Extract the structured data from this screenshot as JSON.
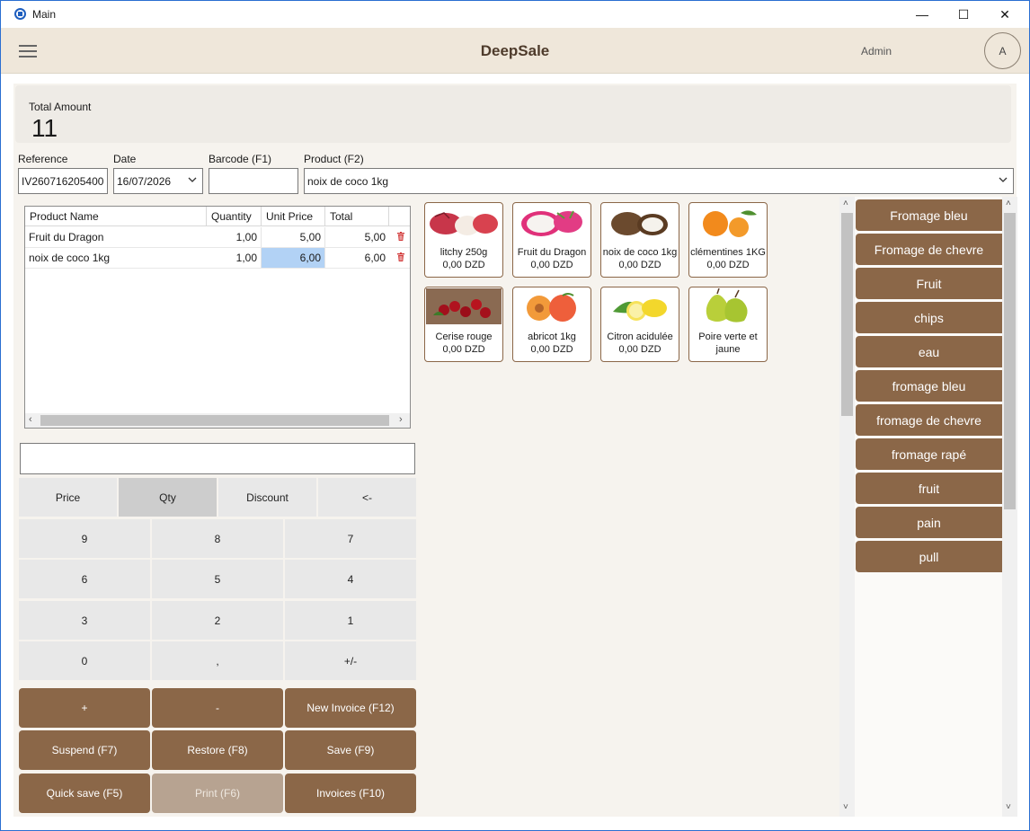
{
  "window": {
    "title": "Main",
    "min_glyph": "—",
    "max_glyph": "☐",
    "close_glyph": "✕"
  },
  "header": {
    "app_name": "DeepSale",
    "user": "Admin",
    "avatar_initial": "A"
  },
  "total": {
    "label": "Total Amount",
    "value": "11"
  },
  "fields": {
    "reference": {
      "label": "Reference",
      "value": "IV260716205400"
    },
    "date": {
      "label": "Date",
      "value": "16/07/2026"
    },
    "barcode": {
      "label": "Barcode (F1)",
      "value": ""
    },
    "product": {
      "label": "Product (F2)",
      "value": "noix de coco 1kg"
    }
  },
  "grid": {
    "columns": [
      "Product Name",
      "Quantity",
      "Unit Price",
      "Total"
    ],
    "rows": [
      {
        "name": "Fruit du Dragon",
        "qty": "1,00",
        "price": "5,00",
        "total": "5,00"
      },
      {
        "name": "noix de coco 1kg",
        "qty": "1,00",
        "price": "6,00",
        "total": "6,00"
      }
    ]
  },
  "keypad": {
    "modes": [
      "Price",
      "Qty",
      "Discount",
      "<-"
    ],
    "active_mode": "Qty",
    "keys": [
      "9",
      "8",
      "7",
      "6",
      "5",
      "4",
      "3",
      "2",
      "1",
      "0",
      ",",
      "+/-"
    ]
  },
  "actions": {
    "plus": "+",
    "minus": "-",
    "new_invoice": "New Invoice (F12)",
    "suspend": "Suspend (F7)",
    "restore": "Restore (F8)",
    "save": "Save (F9)",
    "quick_save": "Quick save (F5)",
    "print": "Print (F6)",
    "invoices": "Invoices (F10)"
  },
  "products": [
    {
      "name": "litchy 250g",
      "price": "0,00 DZD"
    },
    {
      "name": "Fruit du Dragon",
      "price": "0,00 DZD"
    },
    {
      "name": "noix de coco 1kg",
      "price": "0,00 DZD"
    },
    {
      "name": "clémentines 1KG",
      "price": "0,00 DZD"
    },
    {
      "name": "Cerise rouge",
      "price": "0,00 DZD"
    },
    {
      "name": "abricot 1kg",
      "price": "0,00 DZD"
    },
    {
      "name": "Citron acidulée",
      "price": "0,00 DZD"
    },
    {
      "name": "Poire verte et jaune",
      "price": ""
    }
  ],
  "categories": [
    "Fromage bleu",
    "Fromage de chevre",
    "Fruit",
    "chips",
    "eau",
    "fromage bleu",
    "fromage de chevre",
    "fromage rapé",
    "fruit",
    "pain",
    "pull"
  ],
  "colors": {
    "accent": "#8b6748",
    "header_bg": "#efe7da",
    "selected_cell": "#b2d2f5"
  }
}
